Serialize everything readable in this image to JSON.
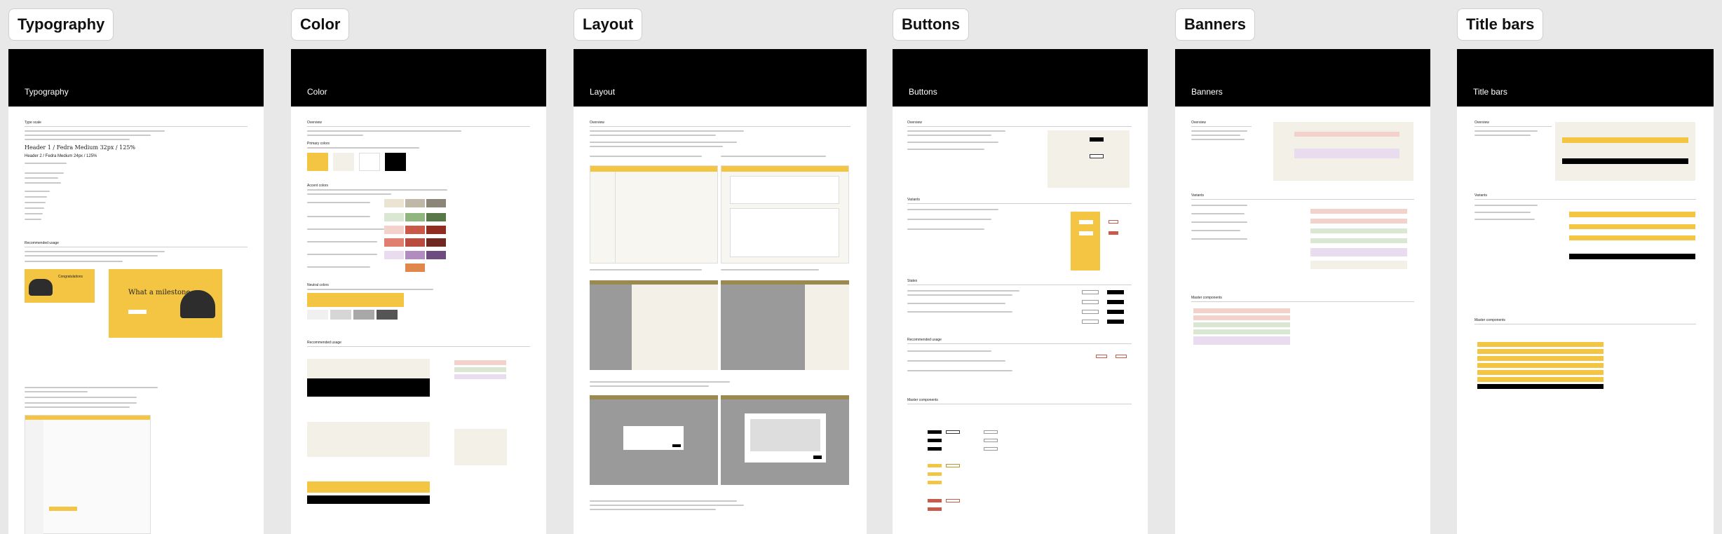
{
  "frames": [
    {
      "id": "typography",
      "label": "Typography",
      "header": "Typography",
      "sections": {
        "s1": "Type scale",
        "s2": "Recommended usage",
        "heading1": "Header 1 / Fedra Medium 32px / 125%",
        "heading2": "Header 2 / Fedra Medium 24px / 125%",
        "milestone": "What a milestone",
        "congrats": "Congratulations"
      }
    },
    {
      "id": "color",
      "label": "Color",
      "header": "Color",
      "sections": {
        "s1": "Overview",
        "s2": "Primary colors",
        "s3": "Accent colors",
        "s4": "Neutral colors",
        "s5": "Recommended usage"
      }
    },
    {
      "id": "layout",
      "label": "Layout",
      "header": "Layout",
      "sections": {
        "s1": "Overview"
      }
    },
    {
      "id": "buttons",
      "label": "Buttons",
      "header": "Buttons",
      "sections": {
        "s1": "Overview",
        "s2": "Variants",
        "s3": "States",
        "s4": "Recommended usage",
        "s5": "Master components"
      }
    },
    {
      "id": "banners",
      "label": "Banners",
      "header": "Banners",
      "sections": {
        "s1": "Overview",
        "s2": "Variants",
        "s3": "Master components"
      }
    },
    {
      "id": "titlebars",
      "label": "Title bars",
      "header": "Title bars",
      "sections": {
        "s1": "Overview",
        "s2": "Variants",
        "s3": "Master components"
      }
    }
  ]
}
